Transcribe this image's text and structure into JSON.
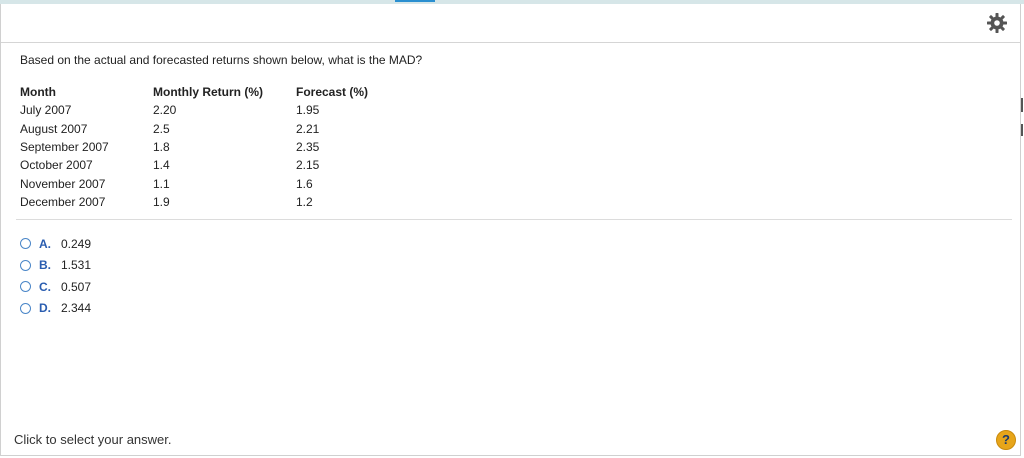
{
  "header": {
    "settings_icon": "gear-icon"
  },
  "question": {
    "prompt": "Based on the actual and forecasted returns shown below, what is the MAD?"
  },
  "table": {
    "headers": [
      "Month",
      "Monthly Return (%)",
      "Forecast (%)"
    ],
    "rows": [
      [
        "July 2007",
        "2.20",
        "1.95"
      ],
      [
        "August 2007",
        "2.5",
        "2.21"
      ],
      [
        "September 2007",
        "1.8",
        "2.35"
      ],
      [
        "October 2007",
        "1.4",
        "2.15"
      ],
      [
        "November 2007",
        "1.1",
        "1.6"
      ],
      [
        "December 2007",
        "1.9",
        "1.2"
      ]
    ]
  },
  "options": [
    {
      "letter": "A.",
      "value": "0.249"
    },
    {
      "letter": "B.",
      "value": "1.531"
    },
    {
      "letter": "C.",
      "value": "0.507"
    },
    {
      "letter": "D.",
      "value": "2.344"
    }
  ],
  "footer": {
    "instruction": "Click to select your answer.",
    "help_label": "?"
  },
  "colors": {
    "accent": "#2a8fd0",
    "option_letter": "#2a5db0",
    "help_bg": "#e7a51a"
  }
}
